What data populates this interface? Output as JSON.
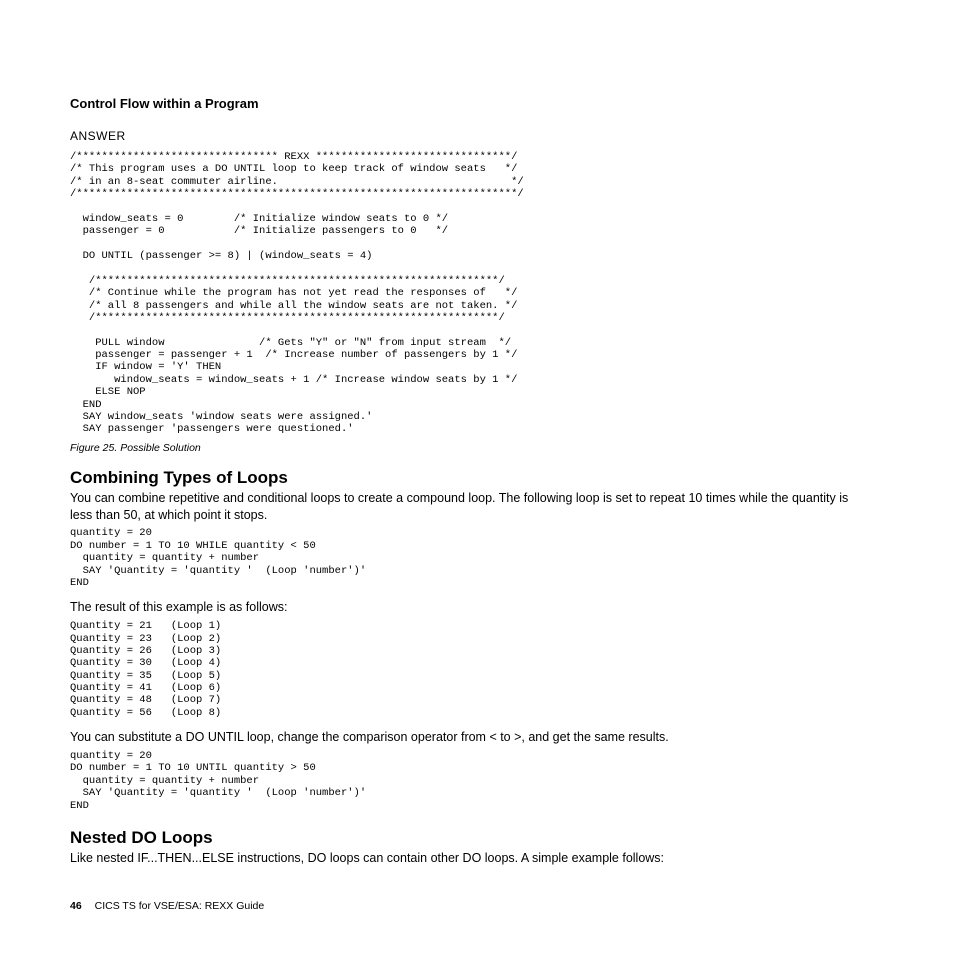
{
  "header": {
    "section": "Control Flow within a Program"
  },
  "answer_label": "ANSWER",
  "code1": "/******************************** REXX *******************************/\n/* This program uses a DO UNTIL loop to keep track of window seats   */\n/* in an 8-seat commuter airline.                                     */\n/**********************************************************************/\n\n  window_seats = 0        /* Initialize window seats to 0 */\n  passenger = 0           /* Initialize passengers to 0   */\n\n  DO UNTIL (passenger >= 8) | (window_seats = 4)\n\n   /****************************************************************/\n   /* Continue while the program has not yet read the responses of   */\n   /* all 8 passengers and while all the window seats are not taken. */\n   /****************************************************************/\n\n    PULL window               /* Gets \"Y\" or \"N\" from input stream  */\n    passenger = passenger + 1  /* Increase number of passengers by 1 */\n    IF window = 'Y' THEN\n       window_seats = window_seats + 1 /* Increase window seats by 1 */\n    ELSE NOP\n  END\n  SAY window_seats 'window seats were assigned.'\n  SAY passenger 'passengers were questioned.'",
  "figcap": "Figure 25. Possible Solution",
  "combining": {
    "heading": "Combining Types of Loops",
    "para1": "You can combine repetitive and conditional loops to create a compound loop. The following loop is set to repeat 10 times while the quantity is less than 50, at which point it stops.",
    "code2": "quantity = 20\nDO number = 1 TO 10 WHILE quantity < 50\n  quantity = quantity + number\n  SAY 'Quantity = 'quantity '  (Loop 'number')'\nEND",
    "resline": "The result of this example is as follows:",
    "output": "Quantity = 21   (Loop 1)\nQuantity = 23   (Loop 2)\nQuantity = 26   (Loop 3)\nQuantity = 30   (Loop 4)\nQuantity = 35   (Loop 5)\nQuantity = 41   (Loop 6)\nQuantity = 48   (Loop 7)\nQuantity = 56   (Loop 8)",
    "para2": "You can substitute a DO UNTIL loop, change the comparison operator from < to >, and get the same results.",
    "code3": "quantity = 20\nDO number = 1 TO 10 UNTIL quantity > 50\n  quantity = quantity + number\n  SAY 'Quantity = 'quantity '  (Loop 'number')'\nEND"
  },
  "nested": {
    "heading": "Nested DO Loops",
    "para": "Like nested IF...THEN...ELSE instructions, DO loops can contain other DO loops. A simple example follows:"
  },
  "footer": {
    "pagenum": "46",
    "title": "CICS TS for VSE/ESA:  REXX Guide"
  },
  "chart_data": {
    "type": "table",
    "title": "Loop output (Quantity vs Loop number)",
    "columns": [
      "Loop",
      "Quantity"
    ],
    "rows": [
      [
        1,
        21
      ],
      [
        2,
        23
      ],
      [
        3,
        26
      ],
      [
        4,
        30
      ],
      [
        5,
        35
      ],
      [
        6,
        41
      ],
      [
        7,
        48
      ],
      [
        8,
        56
      ]
    ]
  }
}
